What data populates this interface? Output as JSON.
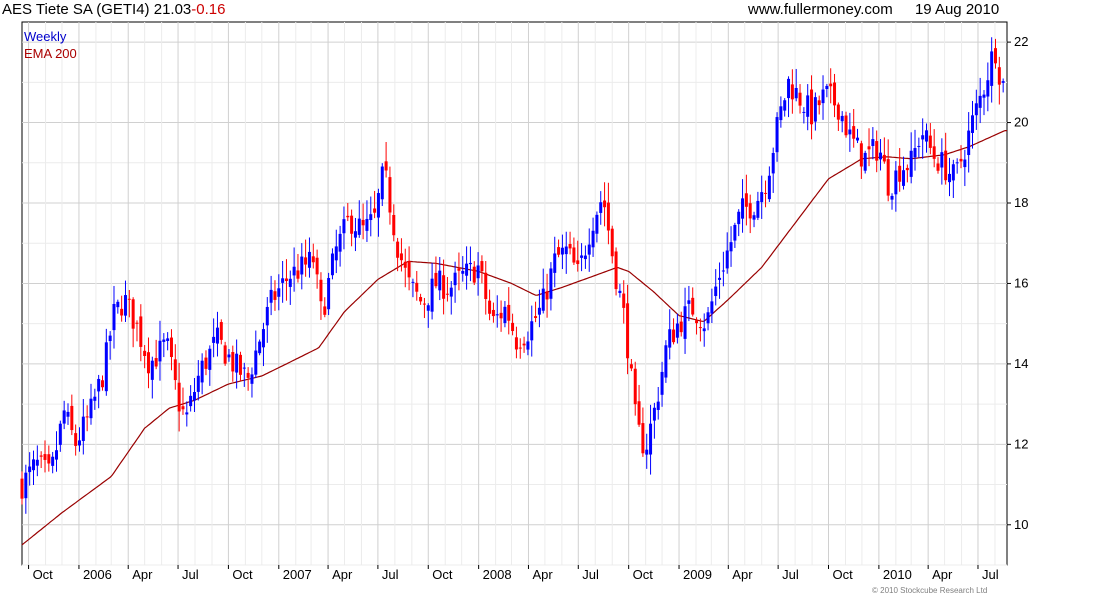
{
  "header": {
    "title": "AES Tiete SA (GETI4)",
    "last": "21.03",
    "change": "-0.16",
    "site": "www.fullermoney.com",
    "date": "19 Aug 2010"
  },
  "legend": {
    "weekly": "Weekly",
    "ema": "EMA 200",
    "weekly_color": "#0000cc",
    "ema_color": "#aa0000"
  },
  "footer": {
    "copyright": "© 2010 Stockcube Research Ltd"
  },
  "colors": {
    "up": "#0000ff",
    "down": "#ff0000",
    "ema": "#990000",
    "grid": "#d0d0d0",
    "grid_minor": "#ececec"
  },
  "chart_data": {
    "type": "candlestick",
    "interval": "weekly",
    "xlim": [
      "2005-09-19",
      "2010-08-23"
    ],
    "ylim": [
      9,
      22.5
    ],
    "y_ticks": [
      10,
      12,
      14,
      16,
      18,
      20,
      22
    ],
    "y_axis_side": "right",
    "grid": true,
    "x_ticks": [
      {
        "label": "Oct",
        "date": "2005-10-01"
      },
      {
        "label": "2006",
        "date": "2006-01-01"
      },
      {
        "label": "Apr",
        "date": "2006-04-01"
      },
      {
        "label": "Jul",
        "date": "2006-07-01"
      },
      {
        "label": "Oct",
        "date": "2006-10-01"
      },
      {
        "label": "2007",
        "date": "2007-01-01"
      },
      {
        "label": "Apr",
        "date": "2007-04-01"
      },
      {
        "label": "Jul",
        "date": "2007-07-01"
      },
      {
        "label": "Oct",
        "date": "2007-10-01"
      },
      {
        "label": "2008",
        "date": "2008-01-01"
      },
      {
        "label": "Apr",
        "date": "2008-04-01"
      },
      {
        "label": "Jul",
        "date": "2008-07-01"
      },
      {
        "label": "Oct",
        "date": "2008-10-01"
      },
      {
        "label": "2009",
        "date": "2009-01-01"
      },
      {
        "label": "Apr",
        "date": "2009-04-01"
      },
      {
        "label": "Jul",
        "date": "2009-07-01"
      },
      {
        "label": "Oct",
        "date": "2009-10-01"
      },
      {
        "label": "2010",
        "date": "2010-01-01"
      },
      {
        "label": "Apr",
        "date": "2010-04-01"
      },
      {
        "label": "Jul",
        "date": "2010-07-01"
      }
    ],
    "close_anchors": [
      [
        "2005-09-19",
        11.0
      ],
      [
        "2005-10-15",
        11.5
      ],
      [
        "2005-11-10",
        11.2
      ],
      [
        "2005-12-05",
        12.8
      ],
      [
        "2005-12-25",
        12.0
      ],
      [
        "2006-01-20",
        12.7
      ],
      [
        "2006-02-15",
        13.8
      ],
      [
        "2006-03-05",
        15.2
      ],
      [
        "2006-03-25",
        15.6
      ],
      [
        "2006-04-15",
        15.0
      ],
      [
        "2006-05-10",
        14.0
      ],
      [
        "2006-06-10",
        14.5
      ],
      [
        "2006-07-01",
        13.1
      ],
      [
        "2006-07-15",
        12.6
      ],
      [
        "2006-08-10",
        13.8
      ],
      [
        "2006-09-10",
        14.6
      ],
      [
        "2006-10-10",
        14.0
      ],
      [
        "2006-11-05",
        13.6
      ],
      [
        "2006-12-01",
        14.8
      ],
      [
        "2006-12-20",
        15.6
      ],
      [
        "2007-01-20",
        16.2
      ],
      [
        "2007-02-15",
        16.4
      ],
      [
        "2007-03-05",
        16.6
      ],
      [
        "2007-03-20",
        15.2
      ],
      [
        "2007-04-15",
        16.8
      ],
      [
        "2007-05-10",
        17.6
      ],
      [
        "2007-06-05",
        17.3
      ],
      [
        "2007-06-25",
        17.6
      ],
      [
        "2007-07-12",
        18.8
      ],
      [
        "2007-08-05",
        17.0
      ],
      [
        "2007-08-25",
        16.0
      ],
      [
        "2007-09-20",
        15.5
      ],
      [
        "2007-10-15",
        16.0
      ],
      [
        "2007-11-10",
        15.9
      ],
      [
        "2007-12-05",
        16.2
      ],
      [
        "2008-01-01",
        16.4
      ],
      [
        "2008-01-25",
        15.0
      ],
      [
        "2008-02-20",
        15.4
      ],
      [
        "2008-03-10",
        14.6
      ],
      [
        "2008-03-30",
        14.8
      ],
      [
        "2008-04-25",
        15.4
      ],
      [
        "2008-05-20",
        16.6
      ],
      [
        "2008-06-10",
        16.8
      ],
      [
        "2008-07-01",
        16.2
      ],
      [
        "2008-07-25",
        17.5
      ],
      [
        "2008-08-15",
        18.2
      ],
      [
        "2008-09-05",
        16.4
      ],
      [
        "2008-09-25",
        15.0
      ],
      [
        "2008-10-15",
        12.4
      ],
      [
        "2008-11-01",
        11.9
      ],
      [
        "2008-11-20",
        13.0
      ],
      [
        "2008-12-10",
        14.5
      ],
      [
        "2008-12-30",
        15.0
      ],
      [
        "2009-01-25",
        15.4
      ],
      [
        "2009-02-20",
        15.0
      ],
      [
        "2009-03-15",
        16.2
      ],
      [
        "2009-04-05",
        17.0
      ],
      [
        "2009-04-25",
        17.8
      ],
      [
        "2009-05-20",
        18.0
      ],
      [
        "2009-06-10",
        18.6
      ],
      [
        "2009-07-01",
        20.0
      ],
      [
        "2009-07-20",
        21.0
      ],
      [
        "2009-08-10",
        20.6
      ],
      [
        "2009-09-01",
        20.2
      ],
      [
        "2009-09-25",
        20.7
      ],
      [
        "2009-10-20",
        20.4
      ],
      [
        "2009-11-10",
        19.6
      ],
      [
        "2009-12-05",
        19.1
      ],
      [
        "2010-01-01",
        19.4
      ],
      [
        "2010-01-20",
        18.4
      ],
      [
        "2010-02-10",
        18.9
      ],
      [
        "2010-03-01",
        19.0
      ],
      [
        "2010-03-20",
        19.8
      ],
      [
        "2010-04-10",
        19.2
      ],
      [
        "2010-05-01",
        18.9
      ],
      [
        "2010-05-20",
        18.6
      ],
      [
        "2010-06-10",
        19.5
      ],
      [
        "2010-06-25",
        20.2
      ],
      [
        "2010-07-10",
        20.8
      ],
      [
        "2010-07-20",
        21.3
      ],
      [
        "2010-08-01",
        21.9
      ],
      [
        "2010-08-10",
        21.2
      ],
      [
        "2010-08-19",
        21.03
      ]
    ],
    "ema200_anchors": [
      [
        "2005-09-19",
        9.5
      ],
      [
        "2005-12-01",
        10.3
      ],
      [
        "2006-03-01",
        11.2
      ],
      [
        "2006-05-01",
        12.4
      ],
      [
        "2006-06-15",
        12.9
      ],
      [
        "2006-08-01",
        13.1
      ],
      [
        "2006-10-01",
        13.5
      ],
      [
        "2006-12-01",
        13.7
      ],
      [
        "2007-01-15",
        14.0
      ],
      [
        "2007-03-15",
        14.4
      ],
      [
        "2007-05-01",
        15.3
      ],
      [
        "2007-07-01",
        16.1
      ],
      [
        "2007-08-25",
        16.55
      ],
      [
        "2007-10-15",
        16.5
      ],
      [
        "2008-01-01",
        16.3
      ],
      [
        "2008-03-01",
        16.0
      ],
      [
        "2008-04-15",
        15.7
      ],
      [
        "2008-06-01",
        15.9
      ],
      [
        "2008-08-01",
        16.2
      ],
      [
        "2008-09-10",
        16.4
      ],
      [
        "2008-10-01",
        16.3
      ],
      [
        "2008-11-15",
        15.8
      ],
      [
        "2009-01-01",
        15.2
      ],
      [
        "2009-02-15",
        15.05
      ],
      [
        "2009-04-01",
        15.6
      ],
      [
        "2009-06-01",
        16.4
      ],
      [
        "2009-08-01",
        17.5
      ],
      [
        "2009-10-01",
        18.6
      ],
      [
        "2009-12-01",
        19.1
      ],
      [
        "2010-01-15",
        19.15
      ],
      [
        "2010-03-01",
        19.1
      ],
      [
        "2010-05-01",
        19.2
      ],
      [
        "2010-06-15",
        19.4
      ],
      [
        "2010-08-19",
        19.8
      ]
    ]
  }
}
